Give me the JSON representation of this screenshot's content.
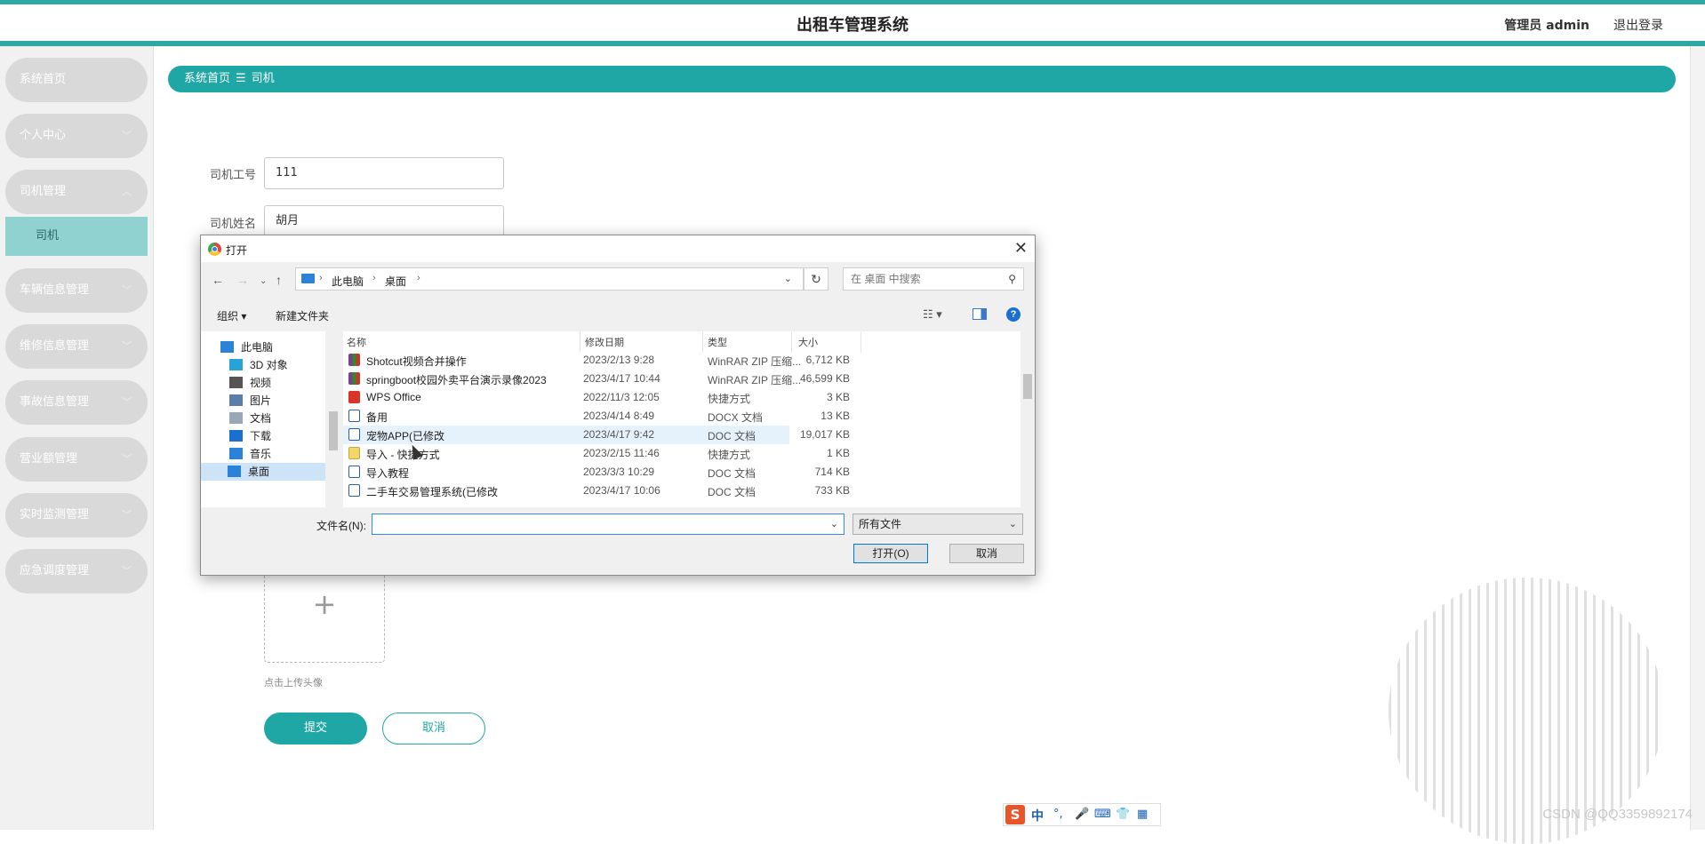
{
  "header": {
    "title": "出租车管理系统",
    "admin": "管理员 admin",
    "logout": "退出登录"
  },
  "sidebar": {
    "items": [
      {
        "label": "系统首页",
        "chevron": ""
      },
      {
        "label": "个人中心",
        "chevron": "﹀"
      },
      {
        "label": "司机管理",
        "chevron": "︿"
      },
      {
        "label": "车辆信息管理",
        "chevron": "﹀"
      },
      {
        "label": "维修信息管理",
        "chevron": "﹀"
      },
      {
        "label": "事故信息管理",
        "chevron": "﹀"
      },
      {
        "label": "营业额管理",
        "chevron": "﹀"
      },
      {
        "label": "实时监测管理",
        "chevron": "﹀"
      },
      {
        "label": "应急调度管理",
        "chevron": "﹀"
      }
    ],
    "sub_item": "司机"
  },
  "breadcrumb": {
    "home": "系统首页",
    "sep": "☰",
    "current": "司机"
  },
  "form": {
    "driver_no_label": "司机工号",
    "driver_no_value": "111",
    "driver_name_label": "司机姓名",
    "driver_name_value": "胡月",
    "upload_plus": "+",
    "upload_hint": "点击上传头像",
    "submit": "提交",
    "cancel": "取消"
  },
  "dialog": {
    "title": "打开",
    "close": "✕",
    "address": {
      "crumb1": "此电脑",
      "crumb2": "桌面"
    },
    "search_placeholder": "在 桌面 中搜索",
    "toolbar": {
      "organize": "组织 ▾",
      "new_folder": "新建文件夹"
    },
    "tree": [
      {
        "label": "此电脑",
        "icon": "pc-icon",
        "color": "#2b82d9"
      },
      {
        "label": "3D 对象",
        "icon": "cube-icon",
        "color": "#27a3d8"
      },
      {
        "label": "视频",
        "icon": "video-icon",
        "color": "#555"
      },
      {
        "label": "图片",
        "icon": "picture-icon",
        "color": "#5a7ea8"
      },
      {
        "label": "文档",
        "icon": "document-icon",
        "color": "#9aa7b6"
      },
      {
        "label": "下载",
        "icon": "download-icon",
        "color": "#1a6fd1"
      },
      {
        "label": "音乐",
        "icon": "music-icon",
        "color": "#2b82d9"
      },
      {
        "label": "桌面",
        "icon": "desktop-icon",
        "color": "#2b82d9"
      }
    ],
    "columns": [
      "名称",
      "修改日期",
      "类型",
      "大小"
    ],
    "files": [
      {
        "name": "Shotcut视频合并操作",
        "date": "2023/2/13 9:28",
        "type": "WinRAR ZIP 压缩...",
        "size": "6,712 KB",
        "icon": "zip"
      },
      {
        "name": "springboot校园外卖平台演示录像2023",
        "date": "2023/4/17 10:44",
        "type": "WinRAR ZIP 压缩...",
        "size": "46,599 KB",
        "icon": "zip"
      },
      {
        "name": "WPS Office",
        "date": "2022/11/3 12:05",
        "type": "快捷方式",
        "size": "3 KB",
        "icon": "wps"
      },
      {
        "name": "备用",
        "date": "2023/4/14 8:49",
        "type": "DOCX 文档",
        "size": "13 KB",
        "icon": "docx"
      },
      {
        "name": "宠物APP(已修改",
        "date": "2023/4/17 9:42",
        "type": "DOC 文档",
        "size": "19,017 KB",
        "icon": "docx"
      },
      {
        "name": "导入 - 快捷方式",
        "date": "2023/2/15 11:46",
        "type": "快捷方式",
        "size": "1 KB",
        "icon": "lnk"
      },
      {
        "name": "导入教程",
        "date": "2023/3/3 10:29",
        "type": "DOC 文档",
        "size": "714 KB",
        "icon": "docx"
      },
      {
        "name": "二手车交易管理系统(已修改",
        "date": "2023/4/17 10:06",
        "type": "DOC 文档",
        "size": "733 KB",
        "icon": "docx"
      }
    ],
    "filename_label": "文件名(N):",
    "filetype": "所有文件",
    "open": "打开(O)",
    "cancel": "取消"
  },
  "ime": {
    "logo": "S",
    "lang": "中"
  },
  "watermark": "CSDN @QQ3359892174"
}
